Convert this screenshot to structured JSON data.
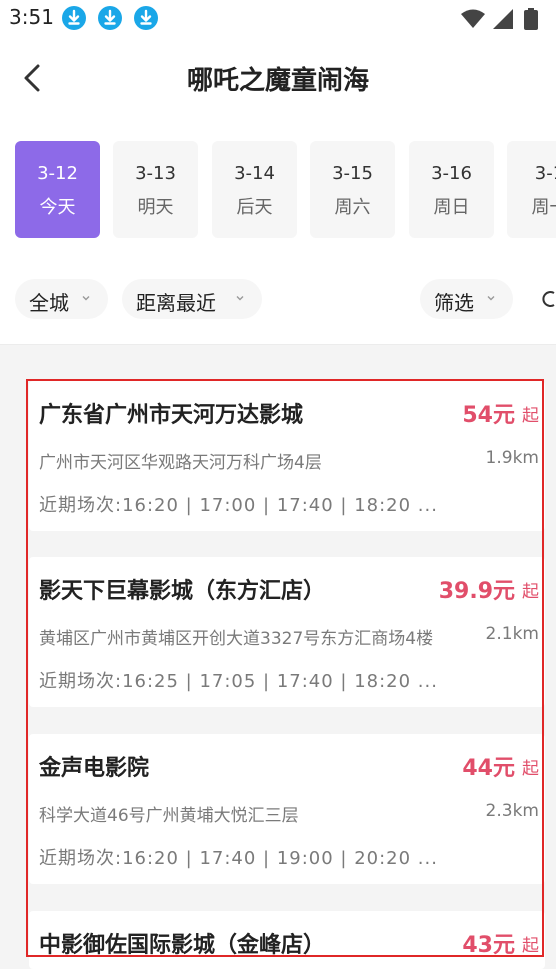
{
  "status_bar": {
    "time": "3:51"
  },
  "header": {
    "title": "哪吒之魔童闹海"
  },
  "date_tabs": [
    {
      "date": "3-12",
      "day": "今天"
    },
    {
      "date": "3-13",
      "day": "明天"
    },
    {
      "date": "3-14",
      "day": "后天"
    },
    {
      "date": "3-15",
      "day": "周六"
    },
    {
      "date": "3-16",
      "day": "周日"
    },
    {
      "date": "3-1",
      "day": "周一"
    }
  ],
  "filters": [
    {
      "label": "全城"
    },
    {
      "label": "距离最近"
    },
    {
      "label": "筛选"
    }
  ],
  "cinemas": [
    {
      "name": "广东省广州市天河万达影城",
      "price": "54元",
      "price_suffix": "起",
      "address": "广州市天河区华观路天河万科广场4层",
      "distance": "1.9km",
      "sessions": "近期场次:16:20 | 17:00 | 17:40 | 18:20 ..."
    },
    {
      "name": "影天下巨幕影城（东方汇店）",
      "price": "39.9元",
      "price_suffix": "起",
      "address": "黄埔区广州市黄埔区开创大道3327号东方汇商场4楼",
      "distance": "2.1km",
      "sessions": "近期场次:16:25 | 17:05 | 17:40 | 18:20 ..."
    },
    {
      "name": "金声电影院",
      "price": "44元",
      "price_suffix": "起",
      "address": "科学大道46号广州黄埔大悦汇三层",
      "distance": "2.3km",
      "sessions": "近期场次:16:20 | 17:40 | 19:00 | 20:20 ..."
    },
    {
      "name": "中影御佐国际影城（金峰店）",
      "price": "43元",
      "price_suffix": "起",
      "address": "",
      "distance": "",
      "sessions": ""
    }
  ],
  "colors": {
    "accent": "#8d6ae8",
    "price": "#e14e6a",
    "download_icon": "#1aa7e8",
    "highlight_border": "#e02727"
  },
  "icons": [
    "download-icon",
    "wifi-icon",
    "signal-icon",
    "battery-icon",
    "back-arrow-icon",
    "chevron-down-icon"
  ]
}
